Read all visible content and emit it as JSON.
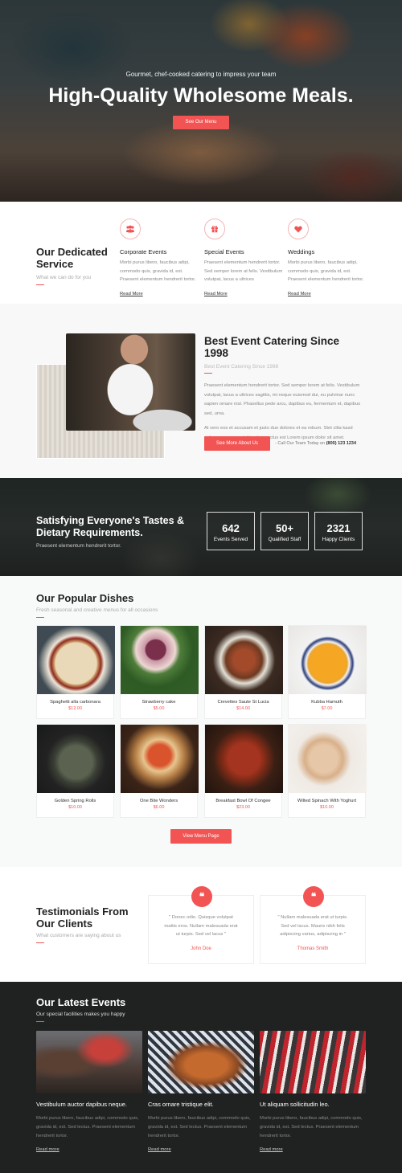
{
  "hero": {
    "subtitle": "Gourmet, chef-cooked catering to impress your team",
    "title": "High-Quality Wholesome Meals.",
    "button": "See Our Menu"
  },
  "services": {
    "title_line1": "Our Dedicated",
    "title_line2": "Service",
    "subtitle": "What we can do for you",
    "items": [
      {
        "icon": "people-icon",
        "title": "Corporate Events",
        "text": "Morbi purus libero, faucibus adipi, commodo quis, gravida id, est. Praesent elementum hendrerit tortor.",
        "link": "Read More"
      },
      {
        "icon": "gift-icon",
        "title": "Special Events",
        "text": "Praesent elementum hendrerit tortor. Sed semper lorem at felis. Vestibulum volutpat, lacus a ultrices",
        "link": "Read More"
      },
      {
        "icon": "heart-icon",
        "title": "Weddings",
        "text": "Morbi purus libero, faucibus adipi, commodo quis, gravida id, est. Praesent elementum hendrerit tortor.",
        "link": "Read More"
      }
    ]
  },
  "about": {
    "title": "Best Event Catering Since 1998",
    "subtitle": "Best Event Catering Since 1998",
    "p1": "Praesent elementum hendrerit tortor. Sed semper lorem at felis. Vestibulum volutpat, lacus a ultrices sagittis, mi neque euismod dui, eu pulvinar nunc sapien ornare nisl. Phasellus pede arcu, dapibus eu, fermentum et, dapibus sed, urna.",
    "p2": "At vero eos et accusam et justo duo dolores et ea rebum. Stet clita kasd gubergren, no sea takimata sanctus est Lorem ipsum dolor sit amet.",
    "button": "See More About Us",
    "call_prefix": "- Call Our Team Today on",
    "phone": "(800) 123 1234"
  },
  "stats": {
    "title_line1": "Satisfying Everyone's Tastes &",
    "title_line2": "Dietary Requirements.",
    "subtitle": "Praesent elementum hendrerit tortor.",
    "items": [
      {
        "number": "642",
        "label": "Events Served"
      },
      {
        "number": "50+",
        "label": "Qualified Staff"
      },
      {
        "number": "2321",
        "label": "Happy Clients"
      }
    ]
  },
  "dishes": {
    "title": "Our Popular Dishes",
    "subtitle": "Fresh seasonal and creative menus for all occasions",
    "items": [
      {
        "name": "Spaghetti alla carbonara",
        "price": "$12.00"
      },
      {
        "name": "Strawberry cake",
        "price": "$5.00"
      },
      {
        "name": "Crevettes Saute St Lucia",
        "price": "$14.00"
      },
      {
        "name": "Kubba Hamuth",
        "price": "$7.00"
      },
      {
        "name": "Golden Spring Rolls",
        "price": "$10.00"
      },
      {
        "name": "One Bite Wonders",
        "price": "$6.00"
      },
      {
        "name": "Breakfast Bowl Of Congee",
        "price": "$23.00"
      },
      {
        "name": "Wilted Spinach With Yoghurt",
        "price": "$10.00"
      }
    ],
    "button": "View Menu Page"
  },
  "testimonials": {
    "title_line1": "Testimonials From",
    "title_line2": "Our Clients",
    "subtitle": "What customers are saying about us",
    "items": [
      {
        "quote": "\" Donec odio. Quisque volutpat mattis eros. Nullam malesuada erat ut turpis. Sed vel lacus \"",
        "author": "John Doe"
      },
      {
        "quote": "\" Nullam malesuada erat ut turpis. Sed vel lacus. Mauris nibh felis adipiscing varius, adipiscing in \"",
        "author": "Thomas Smith"
      }
    ]
  },
  "events": {
    "title": "Our Latest Events",
    "subtitle": "Our special facilities makes you happy",
    "items": [
      {
        "title": "Vestibulum auctor dapibus neque.",
        "text": "Morbi purus libero, faucibus adipi, commodo quis, gravida id, est. Sed lectus. Praesent elementum hendrerit tortor.",
        "link": "Read more"
      },
      {
        "title": "Cras ornare tristique elit.",
        "text": "Morbi purus libero, faucibus adipi, commodo quis, gravida id, est. Sed lectus. Praesent elementum hendrerit tortor.",
        "link": "Read more"
      },
      {
        "title": "Ut aliquam sollicitudin leo.",
        "text": "Morbi purus libero, faucibus adipi, commodo quis, gravida id, est. Sed lectus. Praesent elementum hendrerit tortor.",
        "link": "Read more"
      }
    ]
  },
  "colors": {
    "accent": "#f25454",
    "dark": "#1f2221"
  }
}
